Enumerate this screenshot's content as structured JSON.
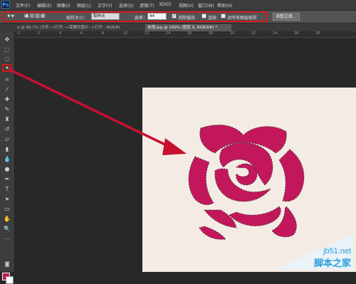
{
  "app": {
    "logo": "Ps"
  },
  "menu": [
    {
      "label": "文件(F)"
    },
    {
      "label": "编辑(E)"
    },
    {
      "label": "图像(I)"
    },
    {
      "label": "图层(L)"
    },
    {
      "label": "文字(Y)"
    },
    {
      "label": "选择(S)"
    },
    {
      "label": "滤镜(T)"
    },
    {
      "label": "3D(D)"
    },
    {
      "label": "视图(V)"
    },
    {
      "label": "窗口(W)"
    },
    {
      "label": "帮助(H)"
    }
  ],
  "options": {
    "sample_size_label": "取样大小：",
    "sample_size_value": "取样点",
    "tolerance_label": "容差：",
    "tolerance_value": "44",
    "anti_alias_label": "消除锯齿",
    "contiguous_label": "连续",
    "sample_all_label": "对所有图层取样",
    "refine_edge_label": "调整边缘..."
  },
  "tabs": [
    {
      "label": "d @ 66.7% (文件-->打开-->需要的图片-->打开 , RGB/8)"
    },
    {
      "label": "玫瑰.jpg @ 100% (图层 0, RGB/8#) *"
    }
  ],
  "ruler": {
    "marks": [
      "-2",
      "0",
      "4",
      "6",
      "8",
      "10",
      "12",
      "14",
      "16",
      "18",
      "20",
      "22",
      "24",
      "26",
      "28"
    ]
  },
  "watermark": {
    "site": "jb51.net",
    "name": "脚本之家"
  },
  "colors": {
    "accent_red": "#d01818",
    "rose": "#c2185b",
    "canvas": "#f4ece4",
    "foreground": "#c2185b",
    "background": "#ffffff"
  }
}
